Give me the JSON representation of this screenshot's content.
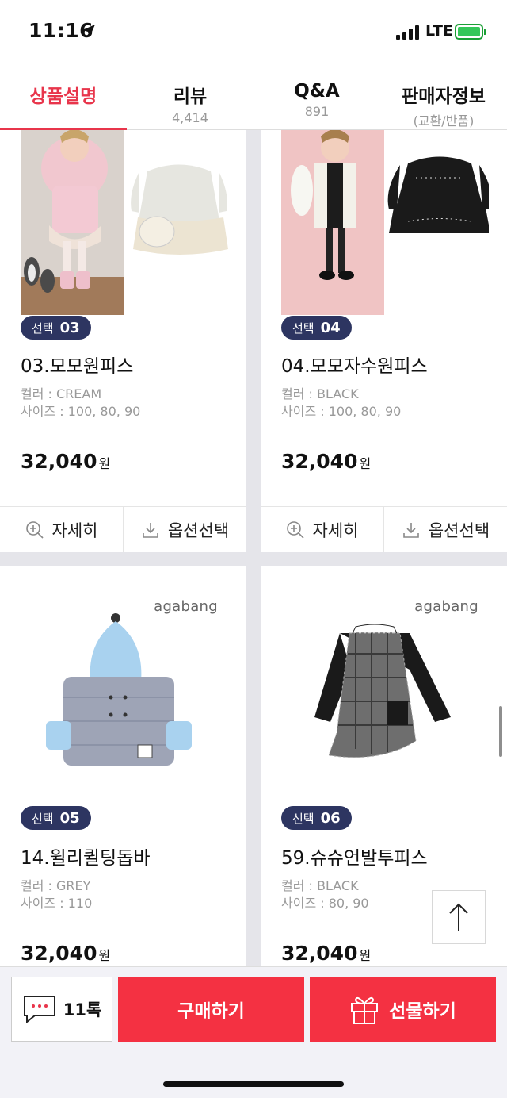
{
  "status_bar": {
    "time": "11:16",
    "network": "LTE"
  },
  "tabs": [
    {
      "label": "상품설명",
      "sub": ""
    },
    {
      "label": "리뷰",
      "sub": "4,414"
    },
    {
      "label": "Q&A",
      "sub": "891"
    },
    {
      "label": "판매자정보",
      "sub": "(교환/반품)"
    }
  ],
  "products": [
    {
      "badge_word": "선택",
      "badge_num": "03",
      "name": "03.모모원피스",
      "color": "컬러 : CREAM",
      "sizes": "사이즈 : 100, 80, 90",
      "price": "32,040",
      "currency": "원",
      "detail_label": "자세히",
      "option_label": "옵션선택",
      "brand": ""
    },
    {
      "badge_word": "선택",
      "badge_num": "04",
      "name": "04.모모자수원피스",
      "color": "컬러 : BLACK",
      "sizes": "사이즈 : 100, 80, 90",
      "price": "32,040",
      "currency": "원",
      "detail_label": "자세히",
      "option_label": "옵션선택",
      "brand": ""
    },
    {
      "badge_word": "선택",
      "badge_num": "05",
      "name": "14.윌리퀼팅돕바",
      "color": "컬러 : GREY",
      "sizes": "사이즈 : 110",
      "price": "32,040",
      "currency": "원",
      "brand": "agabang"
    },
    {
      "badge_word": "선택",
      "badge_num": "06",
      "name": "59.슈슈언발투피스",
      "color": "컬러 : BLACK",
      "sizes": "사이즈 : 80, 90",
      "price": "32,040",
      "currency": "원",
      "brand": "agabang"
    }
  ],
  "bottom_bar": {
    "talk_label": "11톡",
    "buy_label": "구매하기",
    "gift_label": "선물하기"
  },
  "colors": {
    "accent": "#e8354b",
    "buy_button": "#f43142",
    "badge": "#2d3561"
  },
  "icons": [
    "location-arrow-icon",
    "zoom-in-icon",
    "download-icon",
    "chat-bubble-icon",
    "gift-icon",
    "arrow-up-icon"
  ]
}
